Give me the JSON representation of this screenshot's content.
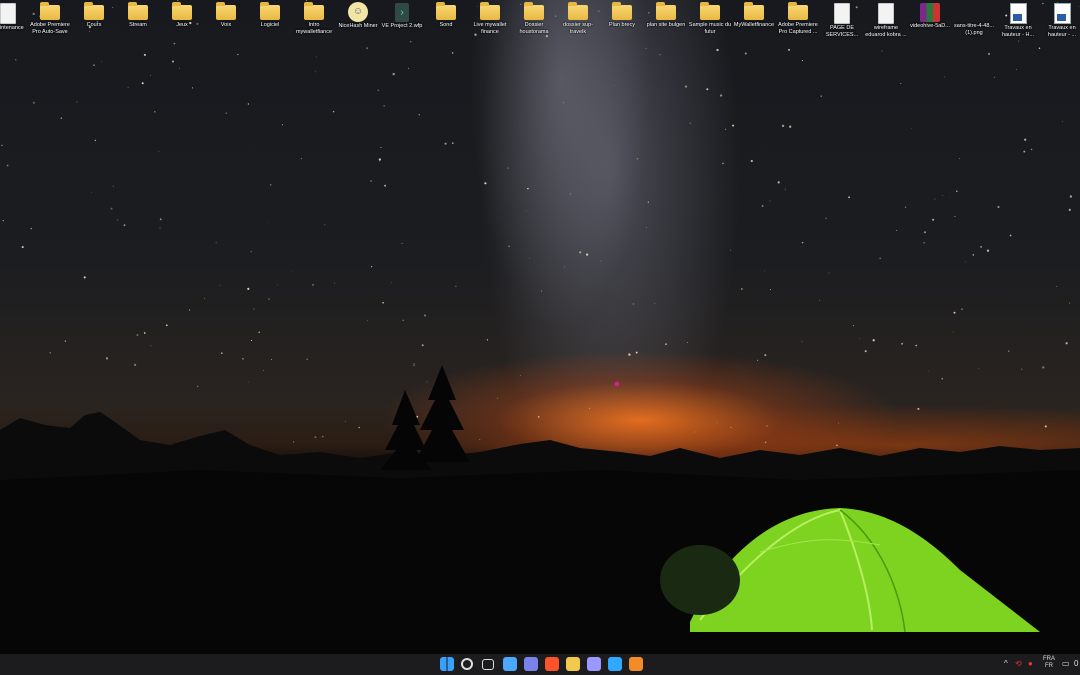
{
  "desktop": {
    "icons": [
      {
        "label": "maintenance",
        "kind": "file"
      },
      {
        "label": "Adobe Premiere Pro Auto-Save",
        "kind": "folder"
      },
      {
        "label": "Cours",
        "kind": "folder"
      },
      {
        "label": "Stream",
        "kind": "folder"
      },
      {
        "label": "Jeux",
        "kind": "folder"
      },
      {
        "label": "Voix",
        "kind": "folder"
      },
      {
        "label": "Logiciel",
        "kind": "folder"
      },
      {
        "label": "Intro mywalletfiance",
        "kind": "folder"
      },
      {
        "label": "NiceHash Miner",
        "kind": "app"
      },
      {
        "label": "VE Project 2.wfp",
        "kind": "wfp"
      },
      {
        "label": "Sond",
        "kind": "folder"
      },
      {
        "label": "Live mywallet finance",
        "kind": "folder"
      },
      {
        "label": "Dossier houstorama",
        "kind": "folder"
      },
      {
        "label": "dossier sup-travelk",
        "kind": "folder"
      },
      {
        "label": "Plan brecy",
        "kind": "folder"
      },
      {
        "label": "plan site bulgen",
        "kind": "folder"
      },
      {
        "label": "Sample music du futur",
        "kind": "folder"
      },
      {
        "label": "MyWalletfinance",
        "kind": "folder"
      },
      {
        "label": "Adobe Premiere Pro Captured ...",
        "kind": "folder"
      },
      {
        "label": "PAGE DE SERVICES...",
        "kind": "doc"
      },
      {
        "label": "wireframe eduarod kobra ...",
        "kind": "doc"
      },
      {
        "label": "videohive-5aD...",
        "kind": "rar"
      },
      {
        "label": "sans-titre-4-48... (1).png",
        "kind": "image"
      },
      {
        "label": "Travaux en hauteur - H...",
        "kind": "docblue"
      },
      {
        "label": "Travaux en hauteur - ...",
        "kind": "docblue"
      }
    ]
  },
  "taskbar": {
    "apps": [
      {
        "name": "start",
        "color": "#3aa0ff"
      },
      {
        "name": "search",
        "color": "#dddddd"
      },
      {
        "name": "task-view",
        "color": "#dddddd"
      },
      {
        "name": "widgets",
        "color": "#4aa8ff"
      },
      {
        "name": "chat",
        "color": "#7b83eb"
      },
      {
        "name": "brave",
        "color": "#fb542b"
      },
      {
        "name": "file-explorer",
        "color": "#f2c94c"
      },
      {
        "name": "premiere-pro",
        "color": "#9999ff"
      },
      {
        "name": "photoshop",
        "color": "#31a8ff"
      },
      {
        "name": "vlc",
        "color": "#f28c28"
      }
    ],
    "tray": {
      "chevron": "^",
      "language_top": "FRA",
      "language_bottom": "FR",
      "clock_partial": "0"
    }
  },
  "colors": {
    "tent": "#7ed321",
    "horizon_glow": "#ff7a1e",
    "taskbar": "#1c1c1f"
  }
}
